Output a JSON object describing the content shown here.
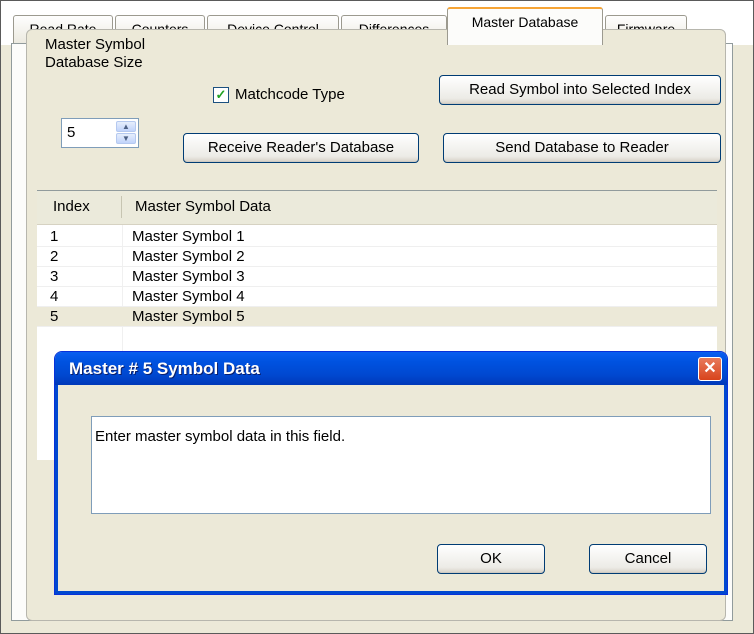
{
  "tabs": [
    {
      "label": "Read Rate"
    },
    {
      "label": "Counters"
    },
    {
      "label": "Device Control"
    },
    {
      "label": "Differences"
    },
    {
      "label": "Master Database",
      "active": true
    },
    {
      "label": "Firmware"
    }
  ],
  "settings": {
    "db_size_label_line1": "Master Symbol",
    "db_size_label_line2": "Database Size",
    "db_size_value": "5",
    "matchcode_label": "Matchcode Type",
    "matchcode_checked": true,
    "read_symbol_button": "Read Symbol into Selected Index",
    "receive_button": "Receive Reader's Database",
    "send_button": "Send Database to Reader"
  },
  "table": {
    "headers": [
      "Index",
      "Master Symbol Data"
    ],
    "rows": [
      {
        "index": "1",
        "data": "Master Symbol 1"
      },
      {
        "index": "2",
        "data": "Master Symbol 2"
      },
      {
        "index": "3",
        "data": "Master Symbol 3"
      },
      {
        "index": "4",
        "data": "Master Symbol 4"
      },
      {
        "index": "5",
        "data": "Master Symbol 5",
        "selected": true
      }
    ]
  },
  "dialog": {
    "title": "Master # 5 Symbol Data",
    "field_value": "Enter master symbol data in this field.",
    "ok_label": "OK",
    "cancel_label": "Cancel",
    "close_icon": "close-icon"
  },
  "colors": {
    "active_tab_accent": "#f6a435",
    "title_bar": "#0052e0",
    "close_button": "#d8431c",
    "window_face": "#ece9d8"
  }
}
